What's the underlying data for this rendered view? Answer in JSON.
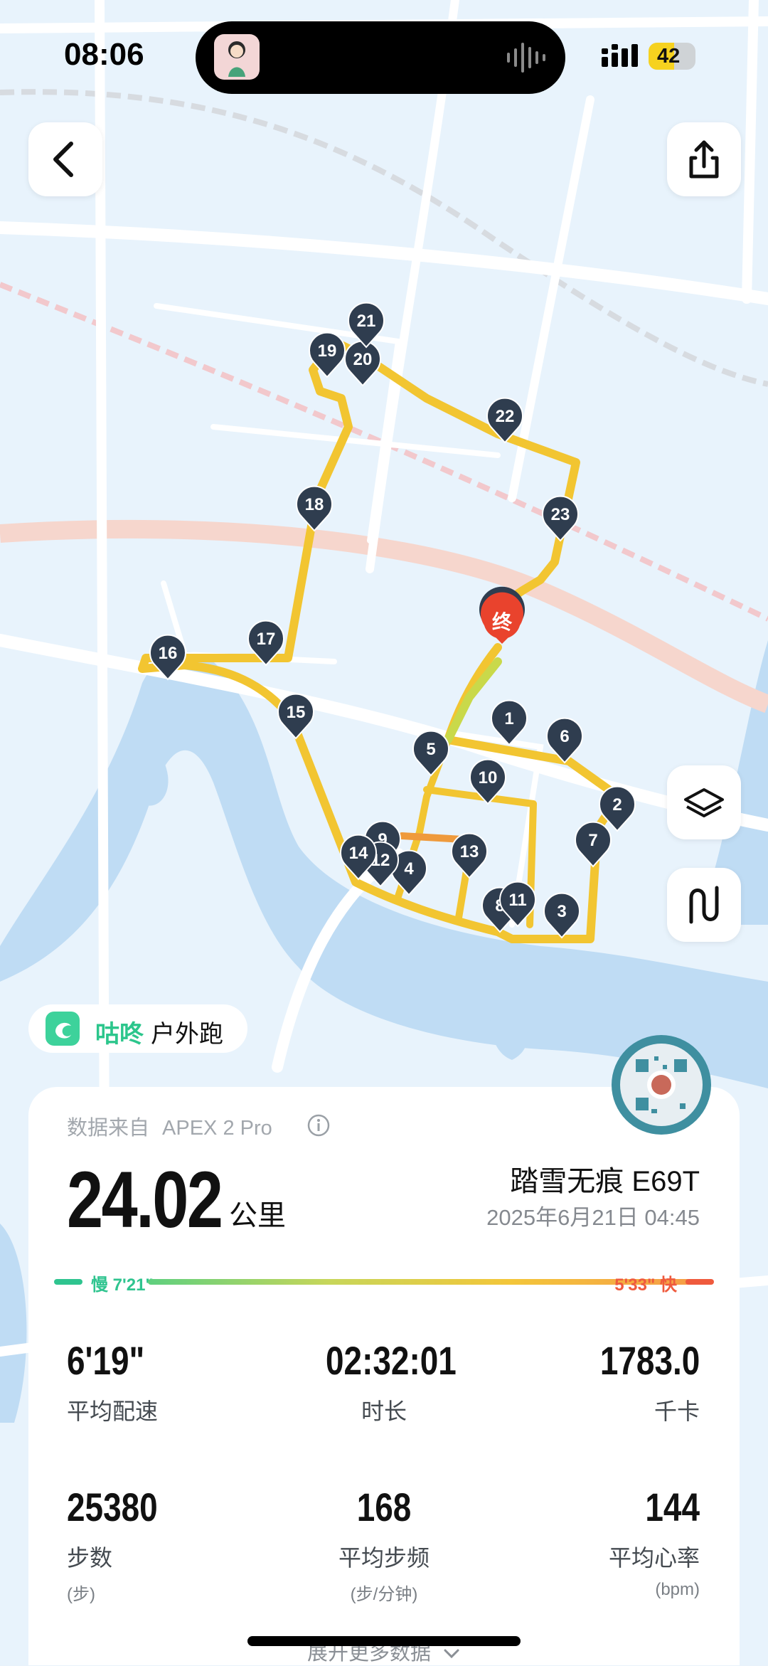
{
  "status_bar": {
    "time": "08:06",
    "battery": "42"
  },
  "map": {
    "end_marker": "终",
    "km_markers": [
      "1",
      "2",
      "3",
      "4",
      "5",
      "6",
      "7",
      "8",
      "9",
      "10",
      "11",
      "12",
      "13",
      "14",
      "15",
      "16",
      "17",
      "18",
      "19",
      "20",
      "21",
      "22",
      "23"
    ]
  },
  "brand": {
    "name_highlight": "咕咚",
    "name_rest": "户外跑"
  },
  "summary": {
    "source_label": "数据来自",
    "device": "APEX 2 Pro",
    "distance": "24.02",
    "distance_unit": "公里",
    "shoe": "踏雪无痕 E69T",
    "datetime": "2025年6月21日 04:45",
    "pace_slow": "慢 7'21\"",
    "pace_fast": "5'33\" 快"
  },
  "stats": [
    {
      "value": "6'19\"",
      "label": "平均配速",
      "sub": ""
    },
    {
      "value": "02:32:01",
      "label": "时长",
      "sub": ""
    },
    {
      "value": "1783.0",
      "label": "千卡",
      "sub": ""
    },
    {
      "value": "25380",
      "label": "步数",
      "sub": "(步)"
    },
    {
      "value": "168",
      "label": "平均步频",
      "sub": "(步/分钟)"
    },
    {
      "value": "144",
      "label": "平均心率",
      "sub": "(bpm)"
    }
  ],
  "more_label": "展开更多数据",
  "colors": {
    "route": "#f2c531",
    "marker": "#2f3d4f",
    "end": "#e9432d",
    "water": "#bcdcf4",
    "road": "#ffffff"
  }
}
